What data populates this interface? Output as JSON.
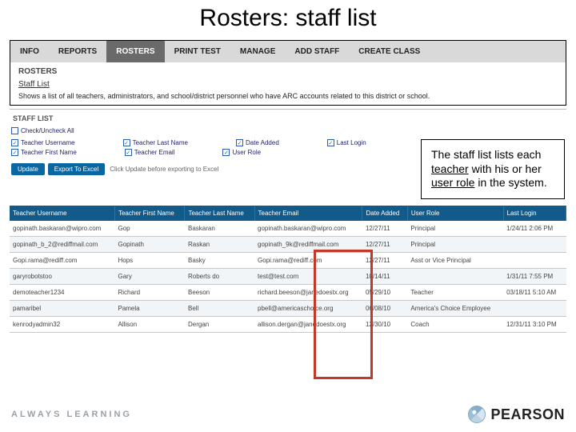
{
  "title": "Rosters: staff list",
  "tabs": [
    "INFO",
    "REPORTS",
    "ROSTERS",
    "PRINT TEST",
    "MANAGE",
    "ADD STAFF",
    "CREATE CLASS"
  ],
  "active_tab_index": 2,
  "rosters": {
    "heading": "ROSTERS",
    "link": "Staff List",
    "desc": "Shows a list of all teachers, administrators, and school/district personnel who have ARC accounts related to this district or school."
  },
  "stafflist": {
    "title": "STAFF LIST",
    "check_all": "Check/Uncheck All",
    "columns_checks": {
      "r1": [
        "Teacher Username",
        "Teacher Last Name",
        "Date Added",
        "Last Login"
      ],
      "r2": [
        "Teacher First Name",
        "Teacher Email",
        "User Role"
      ]
    },
    "buttons": {
      "update": "Update",
      "export": "Export To Excel",
      "hint": "Click Update before exporting to Excel"
    },
    "headers": [
      "Teacher Username",
      "Teacher First Name",
      "Teacher Last Name",
      "Teacher Email",
      "Date Added",
      "User Role",
      "Last Login"
    ],
    "rows": [
      {
        "c": [
          "gopinath.baskaran@wipro.com",
          "Gop",
          "Baskaran",
          "gopinath.baskaran@wipro.com",
          "12/27/11",
          "Principal",
          "1/24/11 2:06 PM"
        ]
      },
      {
        "c": [
          "gopinath_b_2@rediffmail.com",
          "Gopinath",
          "Raskan",
          "gopinath_9k@rediffmail.com",
          "12/27/11",
          "Principal",
          ""
        ]
      },
      {
        "c": [
          "Gopi.rama@rediff.com",
          "Hops",
          "Basky",
          "Gopi.rama@rediff.com",
          "12/27/11",
          "Asst or Vice Principal",
          ""
        ]
      },
      {
        "c": [
          "garyrobotstoo",
          "Gary",
          "Roberts do",
          "test@test.com",
          "10/14/11",
          "",
          "1/31/11 7:55 PM"
        ]
      },
      {
        "c": [
          "demoteacher1234",
          "Richard",
          "Beeson",
          "richard.beeson@janedoestx.org",
          "05/29/10",
          "Teacher",
          "03/18/11 5:10 AM"
        ]
      },
      {
        "c": [
          "pamaribel",
          "Pamela",
          "Bell",
          "pbell@americaschoice.org",
          "06/08/10",
          "America's Choice Employee",
          ""
        ]
      },
      {
        "c": [
          "kenrodyadmin32",
          "Allison",
          "Dergan",
          "allison.dergan@janedoestx.org",
          "12/30/10",
          "Coach",
          "12/31/11 3:10 PM"
        ]
      }
    ]
  },
  "callout": {
    "pre": "The staff list lists each ",
    "hl1": "teacher",
    "mid": " with his or her ",
    "hl2": "user role",
    "post": " in the system."
  },
  "footer": {
    "tagline": "ALWAYS LEARNING",
    "brand": "PEARSON"
  }
}
